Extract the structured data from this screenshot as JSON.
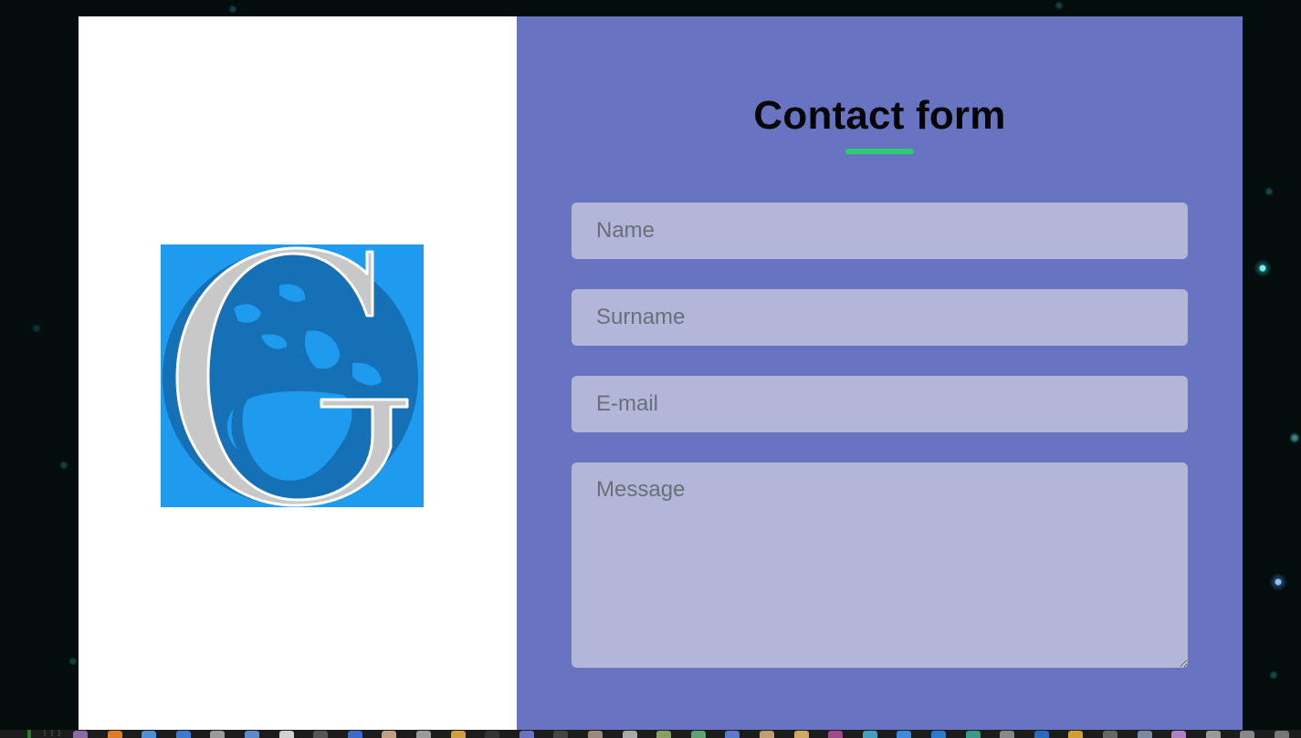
{
  "contact_form": {
    "title": "Contact form",
    "fields": {
      "name_placeholder": "Name",
      "surname_placeholder": "Surname",
      "email_placeholder": "E-mail",
      "message_placeholder": "Message"
    }
  },
  "logo": {
    "icon": "globe-g-logo-icon",
    "letter": "G"
  },
  "colors": {
    "left_panel_bg": "#ffffff",
    "right_panel_bg": "#6873c2",
    "field_bg": "#b2b7da",
    "title_underline": "#2ecc71",
    "logo_bg": "#1e9aee",
    "logo_globe": "#1670b5"
  },
  "taskbar": {
    "apps": [
      {
        "icon": "window-icon",
        "color": "#8a6aa0"
      },
      {
        "icon": "firefox-icon",
        "color": "#e07a24"
      },
      {
        "icon": "chrome-icon",
        "color": "#4a8fd8"
      },
      {
        "icon": "browser-icon",
        "color": "#3a7ad0"
      },
      {
        "icon": "files-icon",
        "color": "#9a9a9a"
      },
      {
        "icon": "store-icon",
        "color": "#5a8acc"
      },
      {
        "icon": "document-icon",
        "color": "#d0d0d0"
      },
      {
        "icon": "camera-icon",
        "color": "#555555"
      },
      {
        "icon": "editor-icon",
        "color": "#3a6ad0"
      },
      {
        "icon": "text-icon",
        "color": "#c0a080"
      },
      {
        "icon": "search-icon",
        "color": "#9a9a9a"
      },
      {
        "icon": "pencil-icon",
        "color": "#d0a040"
      },
      {
        "icon": "terminal-icon",
        "color": "#333333"
      },
      {
        "icon": "app-active-icon",
        "color": "#6873c2"
      },
      {
        "icon": "terminal2-icon",
        "color": "#444444"
      },
      {
        "icon": "download-icon",
        "color": "#9a8a7a"
      },
      {
        "icon": "disk-icon",
        "color": "#aaaaaa"
      },
      {
        "icon": "media-icon",
        "color": "#8aa060"
      },
      {
        "icon": "archive-icon",
        "color": "#60a070"
      },
      {
        "icon": "chat-icon",
        "color": "#5a7ad0"
      },
      {
        "icon": "notes-icon",
        "color": "#c0a070"
      },
      {
        "icon": "folder-icon",
        "color": "#d0a860"
      },
      {
        "icon": "slack-icon",
        "color": "#a04a8a"
      },
      {
        "icon": "globe-icon",
        "color": "#40a0c0"
      },
      {
        "icon": "zoom-icon",
        "color": "#3a8ae0"
      },
      {
        "icon": "vscode-icon",
        "color": "#2a7ad0"
      },
      {
        "icon": "git-icon",
        "color": "#3a9a8a"
      },
      {
        "icon": "refresh-icon",
        "color": "#888888"
      },
      {
        "icon": "vb-icon",
        "color": "#2a6ac0"
      },
      {
        "icon": "sql-icon",
        "color": "#d0a030"
      },
      {
        "icon": "cursor-icon",
        "color": "#666666"
      },
      {
        "icon": "pen-icon",
        "color": "#7a8aa0"
      },
      {
        "icon": "eraser-icon",
        "color": "#b080c0"
      },
      {
        "icon": "trash-icon",
        "color": "#999999"
      },
      {
        "icon": "monitor-icon",
        "color": "#888888"
      },
      {
        "icon": "power-icon",
        "color": "#777777"
      }
    ]
  }
}
